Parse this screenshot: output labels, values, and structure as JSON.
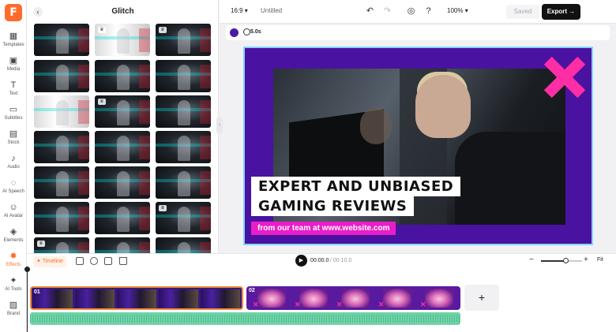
{
  "rail": {
    "logo": "F",
    "items": [
      {
        "label": "Templates",
        "icon": "templates-icon"
      },
      {
        "label": "Media",
        "icon": "media-icon"
      },
      {
        "label": "Text",
        "icon": "text-icon"
      },
      {
        "label": "Subtitles",
        "icon": "subtitles-icon"
      },
      {
        "label": "Stock",
        "icon": "stock-icon"
      },
      {
        "label": "Audio",
        "icon": "audio-icon"
      },
      {
        "label": "AI Speech",
        "icon": "ai-speech-icon"
      },
      {
        "label": "AI Avatar",
        "icon": "ai-avatar-icon"
      },
      {
        "label": "Elements",
        "icon": "elements-icon"
      },
      {
        "label": "Effects",
        "icon": "effects-icon"
      },
      {
        "label": "AI Tools",
        "icon": "ai-tools-icon"
      },
      {
        "label": "Brand",
        "icon": "brand-icon"
      }
    ],
    "active": "Effects"
  },
  "panel": {
    "title": "Glitch",
    "back_icon": "chevron-left-icon"
  },
  "topbar": {
    "ratio": "16:9",
    "project_name": "Untitled",
    "zoom": "100%",
    "saved_label": "Saved",
    "export_label": "Export"
  },
  "canvasbar": {
    "bg_color": "#4a1aa8",
    "duration": "5.0s"
  },
  "slide": {
    "headline_line1": "EXPERT AND UNBIASED",
    "headline_line2": "GAMING REVIEWS",
    "tagline": "from our team at www.website.com",
    "accent_color": "#e81ec8",
    "bg_color": "#4a12a0"
  },
  "timeline": {
    "tab_label": "Timeline",
    "current_time": "00:00.0",
    "total_time": "/ 00:10.0",
    "zoom_level": 0.6,
    "fit_label": "Fit",
    "clips": [
      {
        "num": "01"
      },
      {
        "num": "02"
      }
    ],
    "add_label": "+"
  }
}
